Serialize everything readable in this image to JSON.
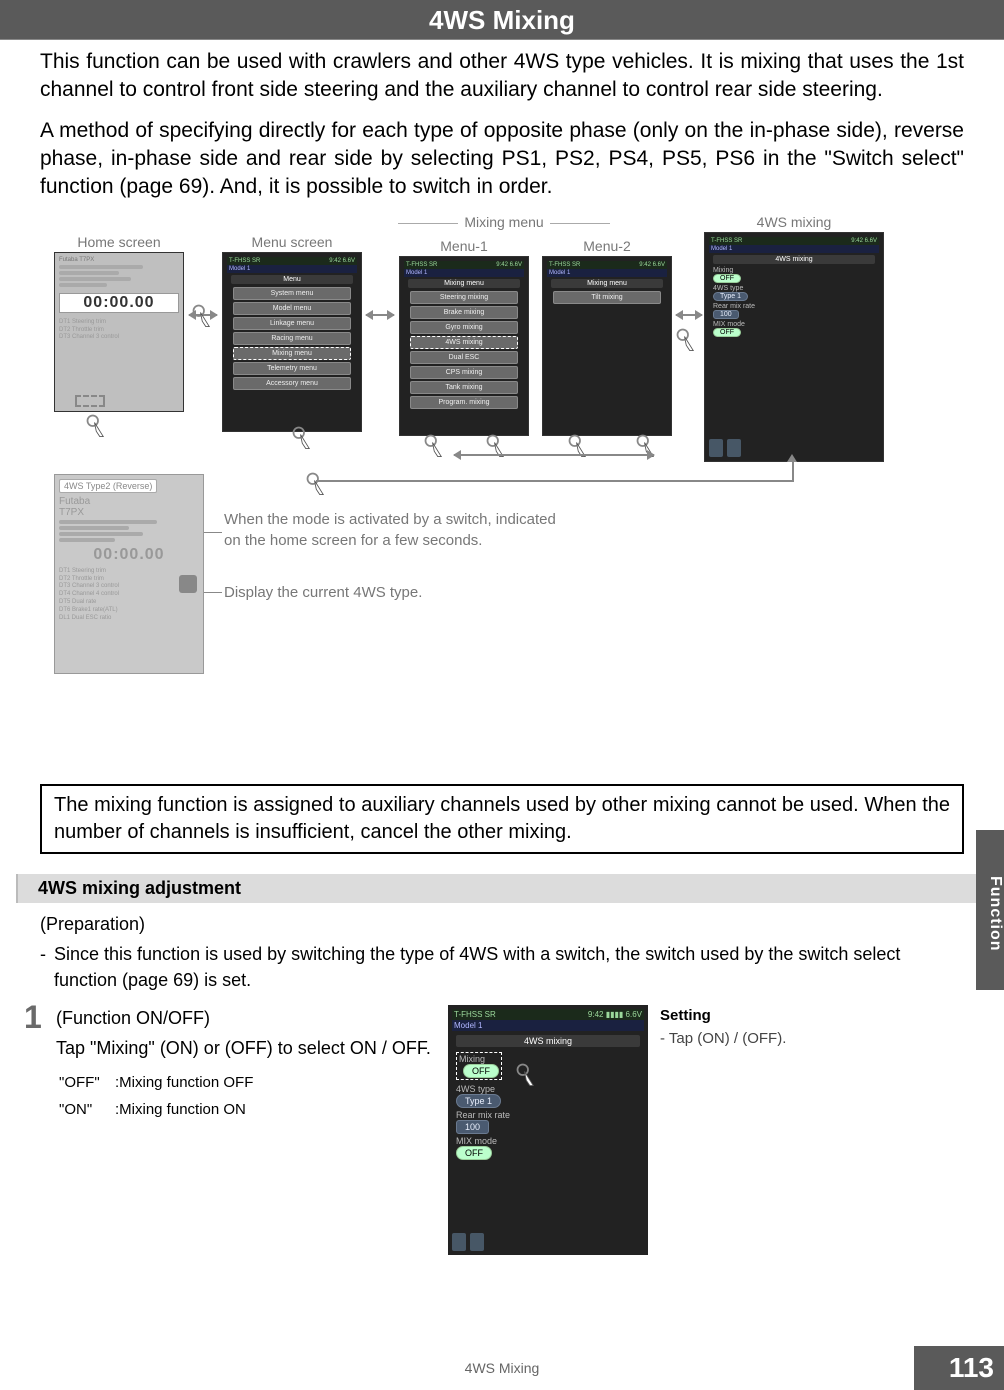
{
  "page": {
    "title": "4WS Mixing",
    "intro_p1": "This function can be used with crawlers and other 4WS type vehicles. It is mixing that uses the 1st channel to control front side steering and the auxiliary channel to control rear side steering.",
    "intro_p2": "A method of specifying directly for each type of opposite phase (only on the in-phase side), reverse phase, in-phase side and rear side by selecting PS1, PS2, PS4, PS5, PS6 in the \"Switch select\" function (page 69).  And, it is possible to switch in order.",
    "note_box": "The mixing function is assigned to auxiliary channels used by other mixing cannot be used. When the number of channels is insufficient, cancel the other mixing.",
    "footer": "4WS Mixing",
    "page_number": "113",
    "side_tab": "Function"
  },
  "diagram": {
    "labels": {
      "home_screen": "Home screen",
      "menu_screen": "Menu screen",
      "mixing_menu": "Mixing menu",
      "menu1": "Menu-1",
      "menu2": "Menu-2",
      "fourws_mixing": "4WS mixing"
    },
    "indicator_line1": "When the mode is activated by a switch, indicated",
    "indicator_line2": "on the home screen for a few seconds.",
    "indicator_sub": "Display the current 4WS type.",
    "home_popup_tag": "4WS Type2 (Reverse)",
    "home_clock": "00:00.00",
    "home_lines": [
      "DT1  Steering trim",
      "DT2  Throttle trim",
      "DT3  Channel 3 control",
      "DT4  Channel 4 control",
      "DT5  Dual rate",
      "DT6  Brake1 rate(ATL)",
      "DL1  Dual ESC ratio"
    ],
    "status": {
      "mode": "T-FHSS SR",
      "time": "9:42",
      "batt": "6.6V",
      "model": "Model 1"
    },
    "menu_header": "Menu",
    "menu_items": [
      "System menu",
      "Model menu",
      "Linkage menu",
      "Racing menu",
      "Mixing menu",
      "Telemetry menu",
      "Accessory menu"
    ],
    "mix1_header": "Mixing menu",
    "mix1_items": [
      "Steering mixing",
      "Brake mixing",
      "Gyro mixing",
      "4WS mixing",
      "Dual ESC",
      "CPS mixing",
      "Tank mixing",
      "Program. mixing"
    ],
    "mix2_header": "Mixing menu",
    "mix2_items": [
      "Tilt mixing"
    ],
    "fourws_header": "4WS mixing",
    "fourws_fields": {
      "mixing_label": "Mixing",
      "mixing_value": "OFF",
      "type_label": "4WS type",
      "type_value": "Type 1",
      "rate_label": "Rear mix rate",
      "rate_value": "100",
      "mode_label": "MIX mode",
      "mode_value": "OFF"
    }
  },
  "adjust": {
    "header": "4WS mixing adjustment",
    "prep_label": "(Preparation)",
    "prep_text": "Since this function is used by switching the type of 4WS with a switch, the switch used by the switch select function (page 69) is set.",
    "step_number": "1",
    "step_title": "(Function ON/OFF)",
    "step_body": "Tap \"Mixing\" (ON) or (OFF) to select ON / OFF.",
    "off_k": "\"OFF\"",
    "off_v": ":Mixing function OFF",
    "on_k": "\"ON\"",
    "on_v": ":Mixing function ON",
    "setting_head": "Setting",
    "setting_line": "- Tap (ON) / (OFF)."
  }
}
